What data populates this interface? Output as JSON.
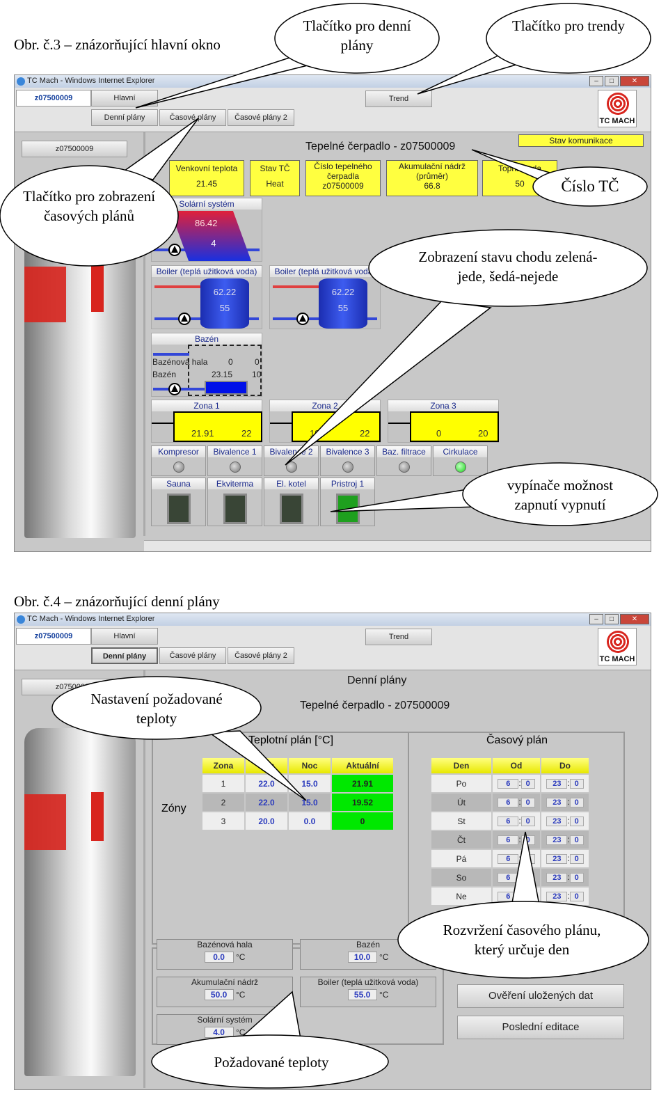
{
  "fig3": {
    "caption": "Obr. č.3 – znázorňující hlavní okno",
    "window_title": "TC Mach - Windows Internet Explorer",
    "tabs": [
      "z07500009",
      "Hlavní"
    ],
    "subtabs": [
      "Denní plány",
      "Časové plány",
      "Časové plány 2"
    ],
    "trend": "Trend",
    "logo": "TC MACH",
    "side_button": "z07500009",
    "title": "Tepelné čerpadlo - z07500009",
    "stav_komunikace": "Stav komunikace",
    "info": [
      {
        "label": "Venkovní teplota",
        "value": "21.45"
      },
      {
        "label": "Stav TČ",
        "value": "Heat"
      },
      {
        "label": "Číslo tepelného čerpadla",
        "value": "z07500009"
      },
      {
        "label": "Akumulační nádrž (průměr)",
        "value": "66.8"
      },
      {
        "label": "Topna voda",
        "value": "50"
      }
    ],
    "solar": {
      "title": "Solární systém",
      "top": "86.42",
      "bottom": "4"
    },
    "boilers": [
      {
        "title": "Boiler (teplá užitková voda)",
        "top": "62.22",
        "bottom": "55"
      },
      {
        "title": "Boiler (teplá užitková voda)",
        "top": "62.22",
        "bottom": "55"
      }
    ],
    "bazen": {
      "title": "Bazén",
      "hala_label": "Bazénová hala",
      "hala_v1": "0",
      "hala_v2": "0",
      "bazen_label": "Bazén",
      "bazen_v1": "23.15",
      "bazen_v2": "10"
    },
    "zones": [
      {
        "title": "Zona 1",
        "actual": "21.91",
        "set": "22"
      },
      {
        "title": "Zona 2",
        "actual": "19",
        "set": "22"
      },
      {
        "title": "Zona 3",
        "actual": "0",
        "set": "20"
      }
    ],
    "indicators": [
      {
        "label": "Kompresor",
        "on": false
      },
      {
        "label": "Bivalence 1",
        "on": false
      },
      {
        "label": "Bivalence 2",
        "on": false
      },
      {
        "label": "Bivalence 3",
        "on": false
      },
      {
        "label": "Baz. filtrace",
        "on": false
      },
      {
        "label": "Cirkulace",
        "on": true
      }
    ],
    "switches": [
      {
        "label": "Sauna",
        "on": false
      },
      {
        "label": "Ekviterma",
        "on": false
      },
      {
        "label": "El. kotel",
        "on": false
      },
      {
        "label": "Pristroj 1",
        "on": true
      }
    ],
    "callouts": [
      "Tlačítko pro denní plány",
      "Tlačítko pro trendy",
      "Tlačítko pro zobrazení časových plánů",
      "Číslo TČ",
      "Zobrazení stavu chodu zelená-jede, šedá-nejede",
      "vypínače možnost zapnutí vypnutí"
    ]
  },
  "fig4": {
    "caption": "Obr. č.4 – znázorňující denní plány",
    "window_title": "TC Mach - Windows Internet Explorer",
    "tabs": [
      "z07500009",
      "Hlavní"
    ],
    "subtabs": [
      "Denní plány",
      "Časové plány",
      "Časové plány 2"
    ],
    "trend": "Trend",
    "logo": "TC MACH",
    "side_button": "z07500009",
    "heading": "Denní plány",
    "title": "Tepelné čerpadlo - z07500009",
    "zony_label": "Zóny",
    "teplotni_title": "Teplotní plán [°C]",
    "teplotni_headers": [
      "Zona",
      "Den",
      "Noc",
      "Aktuální"
    ],
    "teplotni_rows": [
      [
        "1",
        "22.0",
        "15.0",
        "21.91"
      ],
      [
        "2",
        "22.0",
        "15.0",
        "19.52"
      ],
      [
        "3",
        "20.0",
        "0.0",
        "0"
      ]
    ],
    "casovy_title": "Časový plán",
    "casovy_headers": [
      "Den",
      "Od",
      "Do"
    ],
    "casovy_rows": [
      [
        "Po",
        "6",
        "0",
        "23",
        "0"
      ],
      [
        "Út",
        "6",
        "0",
        "23",
        "0"
      ],
      [
        "St",
        "6",
        "0",
        "23",
        "0"
      ],
      [
        "Čt",
        "6",
        "0",
        "23",
        "0"
      ],
      [
        "Pá",
        "6",
        "0",
        "23",
        "0"
      ],
      [
        "So",
        "6",
        "0",
        "23",
        "0"
      ],
      [
        "Ne",
        "6",
        "0",
        "23",
        "0"
      ]
    ],
    "unit": "°C",
    "setpoints": [
      {
        "label": "Bazénová hala",
        "value": "0.0"
      },
      {
        "label": "Bazén",
        "value": "10.0"
      },
      {
        "label": "Akumulační nádrž",
        "value": "50.0"
      },
      {
        "label": "Boiler (teplá užitková voda)",
        "value": "55.0"
      },
      {
        "label": "Solární systém",
        "value": "4.0"
      }
    ],
    "verify_button": "Ověření uložených dat",
    "last_edit_button": "Poslední editace",
    "callouts": [
      "Nastavení požadované teploty",
      "Rozvržení časového plánu, který určuje den",
      "Požadované teploty"
    ]
  }
}
